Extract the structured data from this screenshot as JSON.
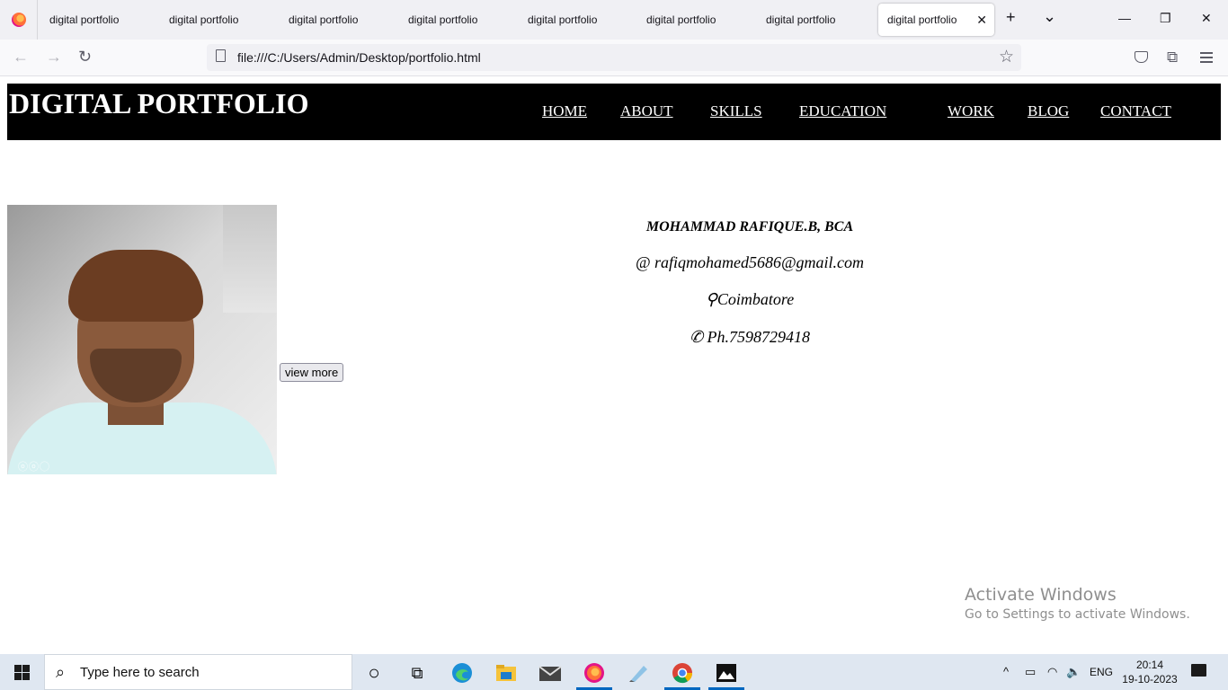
{
  "browser": {
    "tabs": [
      {
        "title": "digital portfolio"
      },
      {
        "title": "digital portfolio"
      },
      {
        "title": "digital portfolio"
      },
      {
        "title": "digital portfolio"
      },
      {
        "title": "digital portfolio"
      },
      {
        "title": "digital portfolio"
      },
      {
        "title": "digital portfolio"
      },
      {
        "title": "digital portfolio",
        "active": true
      }
    ],
    "tab_close": "✕",
    "new_tab": "+",
    "list_tabs": "⌄",
    "window_controls": {
      "minimize": "—",
      "restore": "❐",
      "close": "✕"
    },
    "nav": {
      "back": "←",
      "forward": "→",
      "reload": "↻"
    },
    "url": "file:///C:/Users/Admin/Desktop/portfolio.html",
    "bookmark_star": "☆",
    "extensions": "⧉"
  },
  "page": {
    "site_title": "DIGITAL PORTFOLIO",
    "nav_links": [
      "HOME",
      "ABOUT",
      "SKILLS",
      "EDUCATION",
      "WORK",
      "BLOG",
      "CONTACT"
    ],
    "profile_photo_watermark": "ⓞⓞ◯",
    "view_more_label": "view more",
    "name": "MOHAMMAD RAFIQUE.B, BCA",
    "email_line": "@ rafiqmohamed5686@gmail.com",
    "location_line": "⚲Coimbatore",
    "phone_line": "✆ Ph.7598729418",
    "header_bg": "#000000",
    "header_text_color": "#ffffff"
  },
  "watermark": {
    "line1": "Activate Windows",
    "line2": "Go to Settings to activate Windows."
  },
  "taskbar": {
    "search_placeholder": "Type here to search",
    "search_icon": "⌕",
    "cortana": "○",
    "task_view": "⧉",
    "tray": {
      "chevron": "^",
      "battery": "▭",
      "wifi": "◠",
      "volume": "🔈",
      "language": "ENG"
    },
    "time": "20:14",
    "date": "19-10-2023",
    "pinned_icons": [
      "edge-icon",
      "file-explorer-icon",
      "mail-icon",
      "firefox-icon",
      "notepad-icon",
      "chrome-icon",
      "photos-icon"
    ]
  }
}
